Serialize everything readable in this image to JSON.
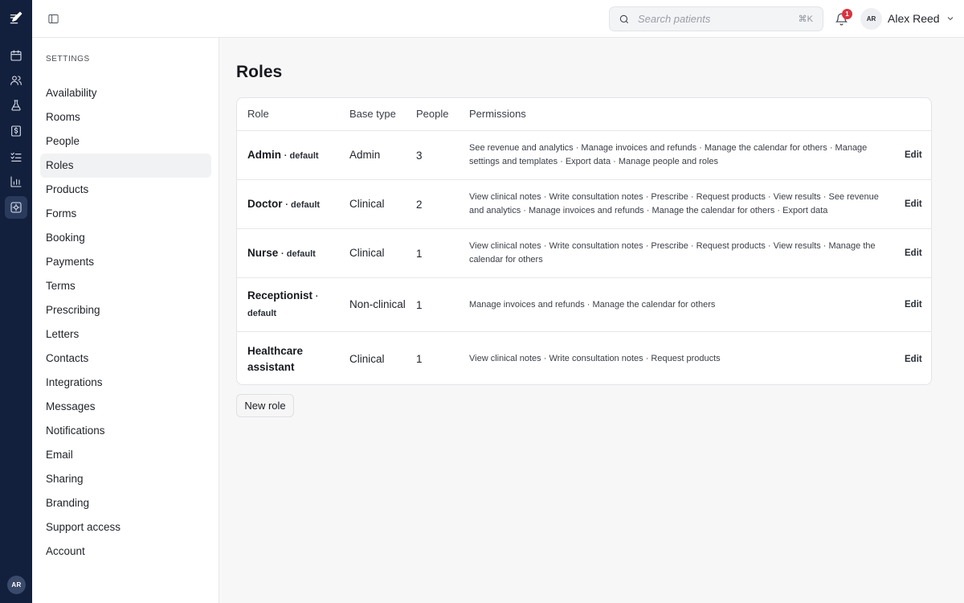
{
  "rail": {
    "items": [
      {
        "icon": "calendar-icon",
        "active": false
      },
      {
        "icon": "users-icon",
        "active": false
      },
      {
        "icon": "flask-icon",
        "active": false
      },
      {
        "icon": "billing-icon",
        "active": false
      },
      {
        "icon": "checklist-icon",
        "active": false
      },
      {
        "icon": "bar-chart-icon",
        "active": false
      },
      {
        "icon": "settings-icon",
        "active": true
      }
    ],
    "avatar_initials": "AR"
  },
  "topbar": {
    "search_placeholder": "Search patients",
    "search_shortcut": "⌘K",
    "notification_count": "1",
    "user_initials": "AR",
    "user_name": "Alex Reed"
  },
  "sidebar": {
    "heading": "SETTINGS",
    "items": [
      {
        "label": "Availability",
        "active": false
      },
      {
        "label": "Rooms",
        "active": false
      },
      {
        "label": "People",
        "active": false
      },
      {
        "label": "Roles",
        "active": true
      },
      {
        "label": "Products",
        "active": false
      },
      {
        "label": "Forms",
        "active": false
      },
      {
        "label": "Booking",
        "active": false
      },
      {
        "label": "Payments",
        "active": false
      },
      {
        "label": "Terms",
        "active": false
      },
      {
        "label": "Prescribing",
        "active": false
      },
      {
        "label": "Letters",
        "active": false
      },
      {
        "label": "Contacts",
        "active": false
      },
      {
        "label": "Integrations",
        "active": false
      },
      {
        "label": "Messages",
        "active": false
      },
      {
        "label": "Notifications",
        "active": false
      },
      {
        "label": "Email",
        "active": false
      },
      {
        "label": "Sharing",
        "active": false
      },
      {
        "label": "Branding",
        "active": false
      },
      {
        "label": "Support access",
        "active": false
      },
      {
        "label": "Account",
        "active": false
      }
    ]
  },
  "main": {
    "title": "Roles",
    "columns": {
      "role": "Role",
      "base_type": "Base type",
      "people": "People",
      "permissions": "Permissions"
    },
    "default_suffix": "· default",
    "edit_label": "Edit",
    "rows": [
      {
        "role": "Admin",
        "is_default": true,
        "base_type": "Admin",
        "people": "3",
        "permissions": "See revenue and analytics · Manage invoices and refunds · Manage the calendar for others · Manage settings and templates · Export data · Manage people and roles"
      },
      {
        "role": "Doctor",
        "is_default": true,
        "base_type": "Clinical",
        "people": "2",
        "permissions": "View clinical notes · Write consultation notes · Prescribe · Request products · View results · See revenue and analytics · Manage invoices and refunds · Manage the calendar for others · Export data"
      },
      {
        "role": "Nurse",
        "is_default": true,
        "base_type": "Clinical",
        "people": "1",
        "permissions": "View clinical notes · Write consultation notes · Prescribe · Request products · View results · Manage the calendar for others"
      },
      {
        "role": "Receptionist",
        "is_default": true,
        "base_type": "Non-clinical",
        "people": "1",
        "permissions": "Manage invoices and refunds · Manage the calendar for others"
      },
      {
        "role": "Healthcare assistant",
        "is_default": false,
        "base_type": "Clinical",
        "people": "1",
        "permissions": "View clinical notes · Write consultation notes · Request products"
      }
    ],
    "new_role_label": "New role"
  }
}
